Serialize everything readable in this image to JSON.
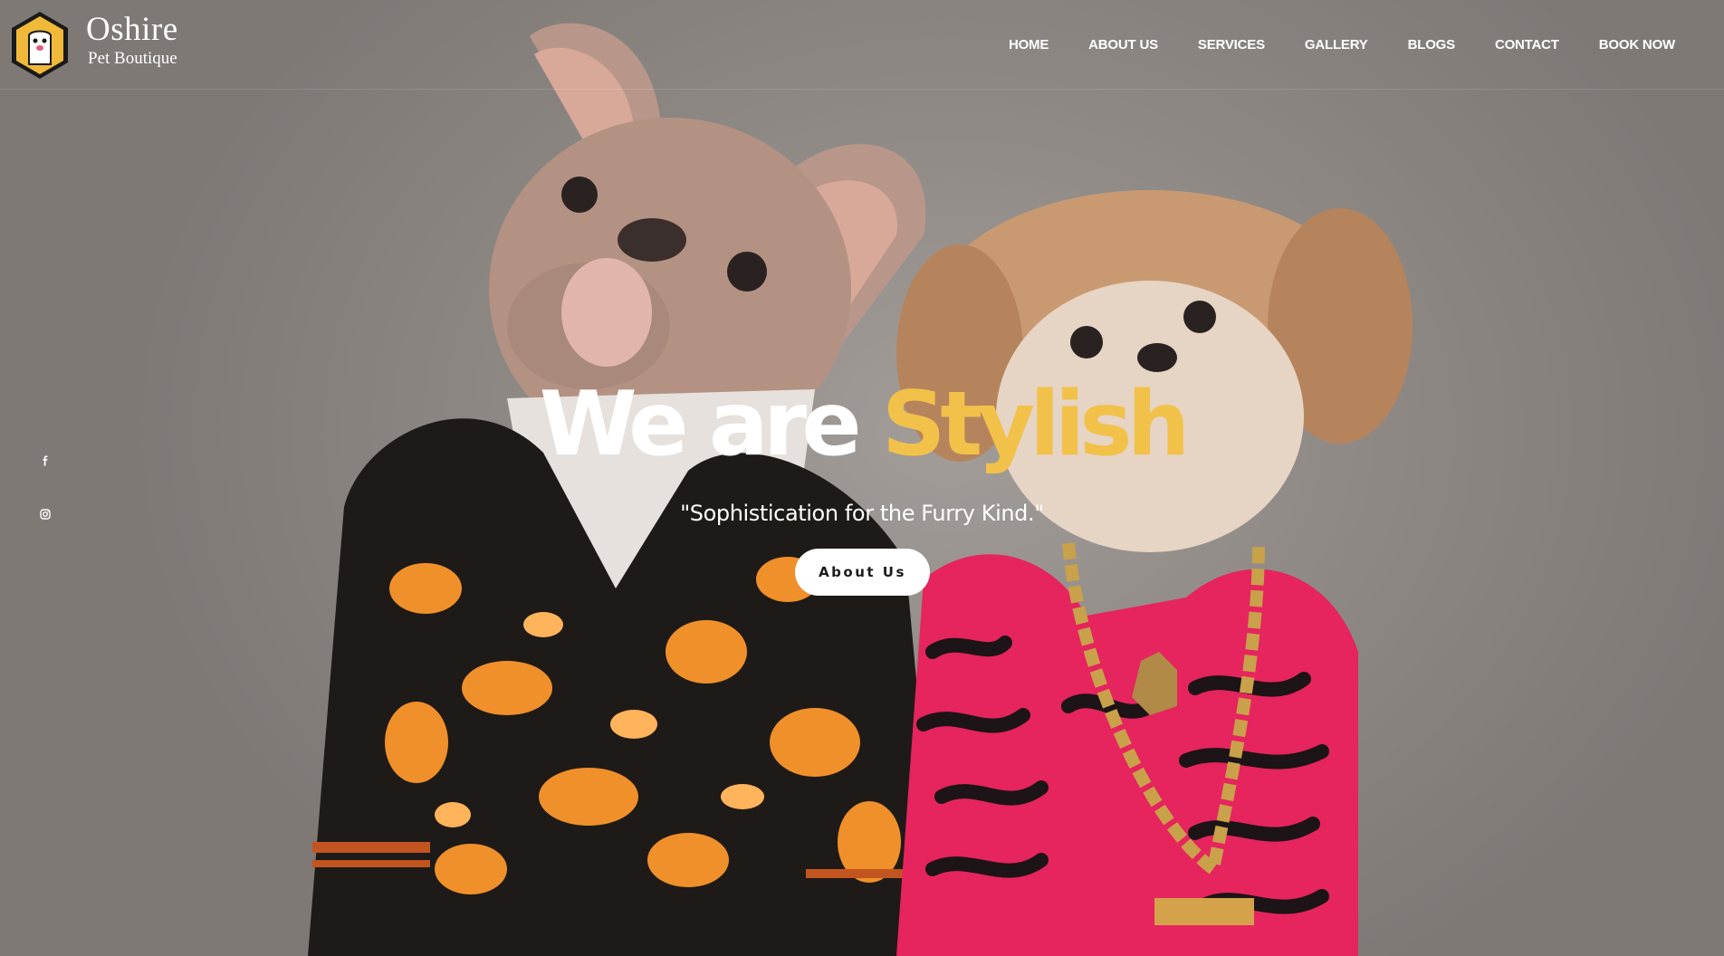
{
  "brand": {
    "name": "Oshire",
    "subtitle": "Pet Boutique"
  },
  "nav": {
    "items": [
      {
        "label": "HOME"
      },
      {
        "label": "ABOUT US"
      },
      {
        "label": "SERVICES"
      },
      {
        "label": "GALLERY"
      },
      {
        "label": "BLOGS"
      },
      {
        "label": "CONTACT"
      },
      {
        "label": "BOOK NOW"
      }
    ]
  },
  "social": {
    "icons": [
      "facebook-icon",
      "instagram-icon"
    ]
  },
  "hero": {
    "headline_main": "We are ",
    "headline_accent": "Stylish",
    "tagline": "\"Sophistication for the Furry Kind.\"",
    "cta_label": "About Us"
  },
  "colors": {
    "accent": "#f2c14a",
    "text": "#ffffff",
    "button_bg": "#ffffff",
    "button_text": "#1b1b1b"
  }
}
